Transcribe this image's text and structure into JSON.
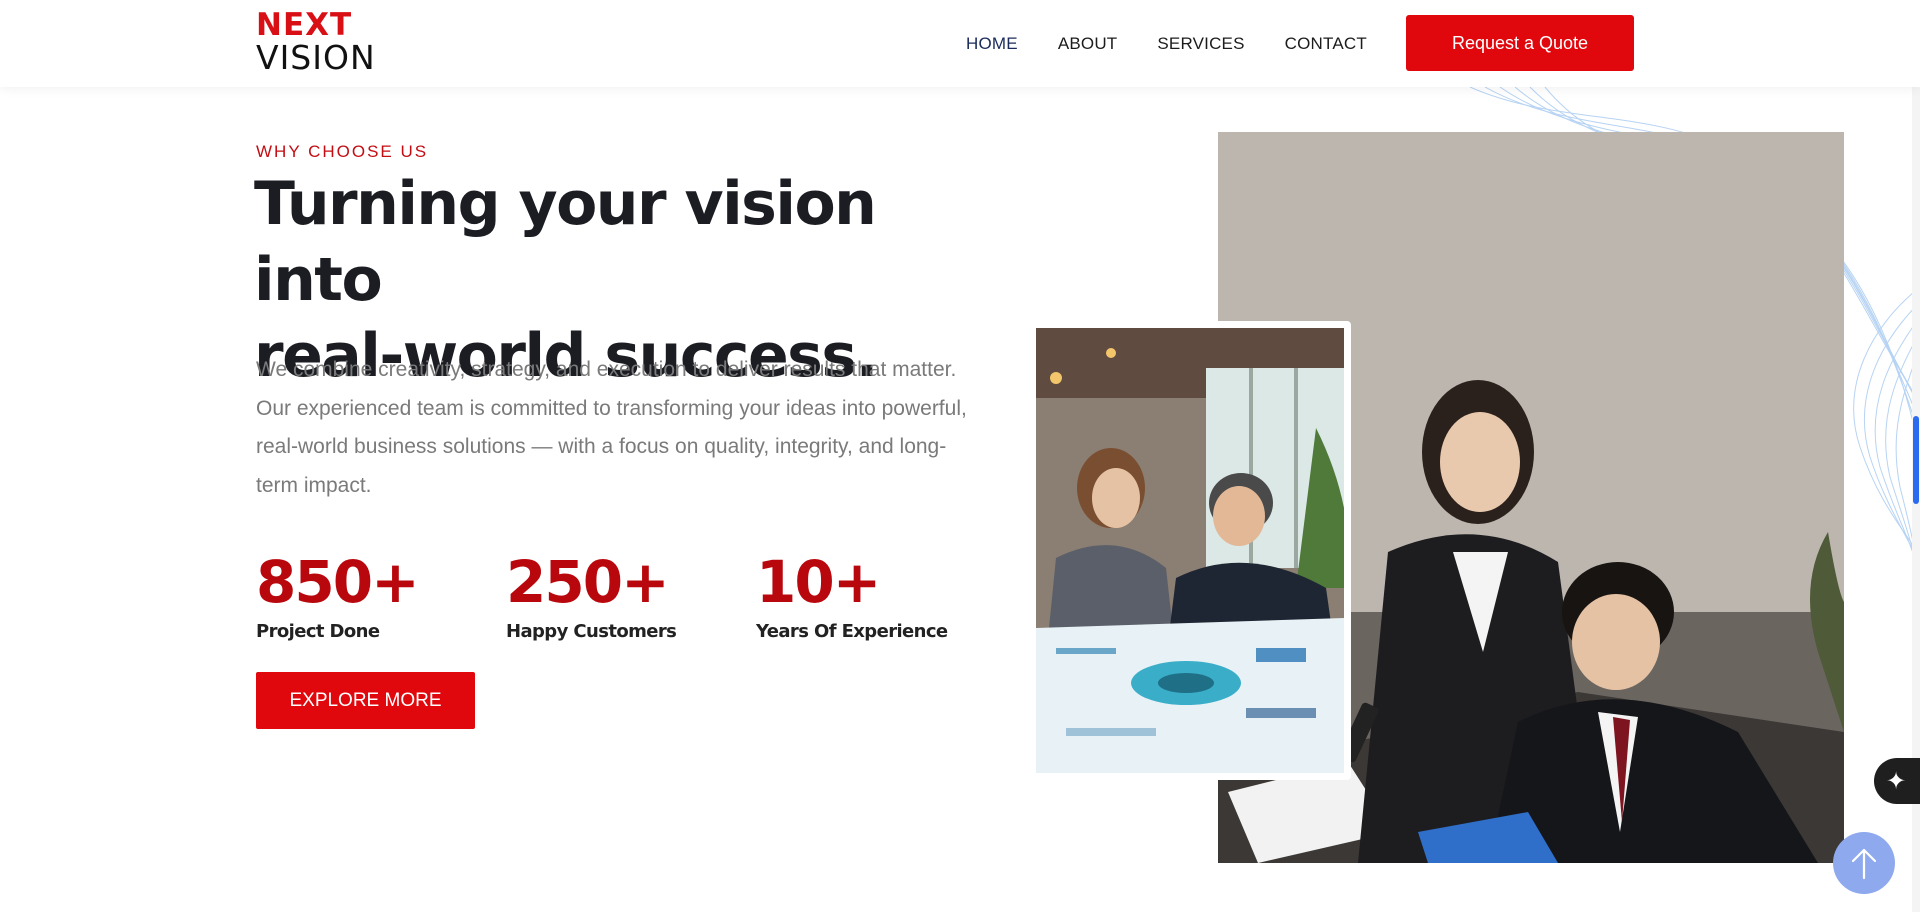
{
  "header": {
    "logo": {
      "top": "NEXT",
      "bottom": "VISION"
    },
    "nav": [
      {
        "label": "HOME",
        "active": true
      },
      {
        "label": "ABOUT",
        "active": false
      },
      {
        "label": "SERVICES",
        "active": false
      },
      {
        "label": "CONTACT",
        "active": false
      }
    ],
    "cta_label": "Request a Quote"
  },
  "hero": {
    "eyebrow": "WHY CHOOSE US",
    "headline_line1": "Turning your vision into",
    "headline_line2": "real-world success.",
    "description": "We combine creativity, strategy, and execution to deliver results that matter. Our experienced team is committed to transforming your ideas into powerful, real-world business solutions — with a focus on quality, integrity, and long-term impact.",
    "stats": [
      {
        "value": "850+",
        "label": "Project Done"
      },
      {
        "value": "250+",
        "label": "Happy Customers"
      },
      {
        "value": "10+",
        "label": "Years Of Experience"
      }
    ],
    "button_label": "EXPLORE MORE"
  },
  "colors": {
    "brand_red": "#e0080d",
    "stat_red": "#b8080d",
    "heading": "#1b1d23",
    "body_text": "#7a7a7a",
    "scroll_top": "#8fa9ee"
  },
  "icons": {
    "ai_widget": "sparkle-icon",
    "scroll_top": "arrow-up-icon"
  }
}
